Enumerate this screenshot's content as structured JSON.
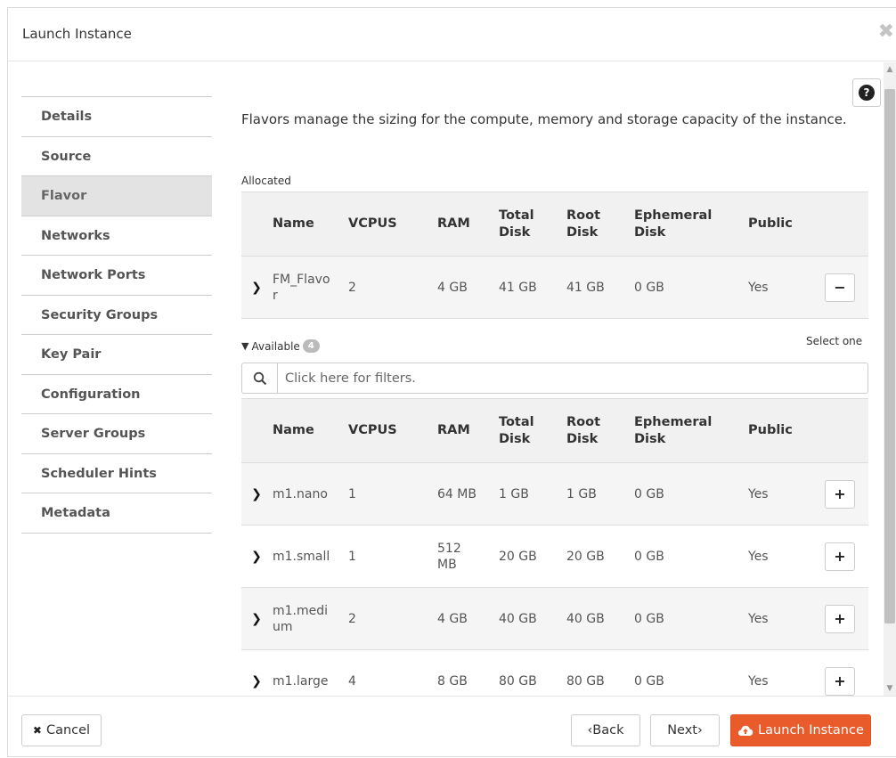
{
  "dialog": {
    "title": "Launch Instance",
    "close_glyph": "✖"
  },
  "wizard": {
    "active": "Flavor",
    "items": [
      {
        "label": "Details"
      },
      {
        "label": "Source"
      },
      {
        "label": "Flavor"
      },
      {
        "label": "Networks"
      },
      {
        "label": "Network Ports"
      },
      {
        "label": "Security Groups"
      },
      {
        "label": "Key Pair"
      },
      {
        "label": "Configuration"
      },
      {
        "label": "Server Groups"
      },
      {
        "label": "Scheduler Hints"
      },
      {
        "label": "Metadata"
      }
    ]
  },
  "help": {
    "glyph": "?"
  },
  "intro": "Flavors manage the sizing for the compute, memory and storage capacity of the instance.",
  "allocated": {
    "label": "Allocated",
    "headers": {
      "name": "Name",
      "vcpus": "VCPUS",
      "ram": "RAM",
      "total_disk": "Total Disk",
      "root_disk": "Root Disk",
      "ephemeral_disk": "Ephemeral Disk",
      "public": "Public"
    },
    "rows": [
      {
        "name": "FM_Flavor",
        "vcpus": "2",
        "ram": "4 GB",
        "total_disk": "41 GB",
        "root_disk": "41 GB",
        "ephemeral_disk": "0 GB",
        "public": "Yes",
        "action": "−"
      }
    ]
  },
  "available": {
    "label": "Available",
    "count": "4",
    "select_hint": "Select one",
    "filter_placeholder": "Click here for filters.",
    "headers": {
      "name": "Name",
      "vcpus": "VCPUS",
      "ram": "RAM",
      "total_disk": "Total Disk",
      "root_disk": "Root Disk",
      "ephemeral_disk": "Ephemeral Disk",
      "public": "Public"
    },
    "rows": [
      {
        "name": "m1.nano",
        "vcpus": "1",
        "ram": "64 MB",
        "total_disk": "1 GB",
        "root_disk": "1 GB",
        "ephemeral_disk": "0 GB",
        "public": "Yes",
        "action": "+"
      },
      {
        "name": "m1.small",
        "vcpus": "1",
        "ram": "512 MB",
        "total_disk": "20 GB",
        "root_disk": "20 GB",
        "ephemeral_disk": "0 GB",
        "public": "Yes",
        "action": "+"
      },
      {
        "name": "m1.medium",
        "vcpus": "2",
        "ram": "4 GB",
        "total_disk": "40 GB",
        "root_disk": "40 GB",
        "ephemeral_disk": "0 GB",
        "public": "Yes",
        "action": "+"
      },
      {
        "name": "m1.large",
        "vcpus": "4",
        "ram": "8 GB",
        "total_disk": "80 GB",
        "root_disk": "80 GB",
        "ephemeral_disk": "0 GB",
        "public": "Yes",
        "action": "+"
      }
    ]
  },
  "footer": {
    "cancel": "Cancel",
    "cancel_icon": "✖",
    "back": "‹Back",
    "next": "Next›",
    "launch": "Launch Instance"
  },
  "colors": {
    "accent": "#e95b2b",
    "active_nav": "#e3e3e3"
  }
}
